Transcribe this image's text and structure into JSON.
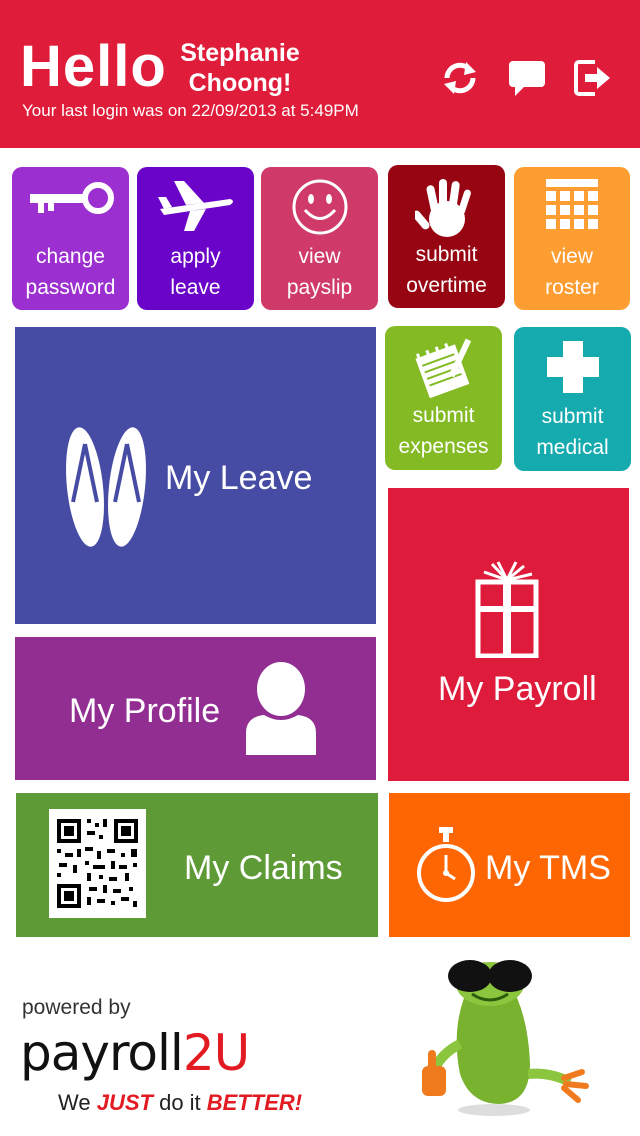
{
  "header": {
    "greeting": "Hello",
    "user_name_line1": "Stephanie",
    "user_name_line2": "Choong!",
    "last_login": "Your last login was on 22/09/2013 at 5:49PM",
    "icons": [
      "refresh-icon",
      "chat-icon",
      "logout-icon"
    ],
    "color": "#df1c39"
  },
  "small_tiles": [
    {
      "line1": "change",
      "line2": "password",
      "icon": "key-icon",
      "color": "#9c2fcf"
    },
    {
      "line1": "apply",
      "line2": "leave",
      "icon": "airplane-icon",
      "color": "#6a04c8"
    },
    {
      "line1": "view",
      "line2": "payslip",
      "icon": "smiley-icon",
      "color": "#cf3a69"
    },
    {
      "line1": "submit",
      "line2": "overtime",
      "icon": "hand-icon",
      "color": "#980512"
    },
    {
      "line1": "view",
      "line2": "roster",
      "icon": "calendar-icon",
      "color": "#fd9d32"
    },
    {
      "line1": "submit",
      "line2": "expenses",
      "icon": "notepad-icon",
      "color": "#84bb25"
    },
    {
      "line1": "submit",
      "line2": "medical",
      "icon": "medical-cross-icon",
      "color": "#14aaae"
    }
  ],
  "big_tiles": {
    "leave": {
      "label": "My Leave",
      "icon": "flip-flops-icon",
      "color": "#464ca4"
    },
    "profile": {
      "label": "My Profile",
      "icon": "person-icon",
      "color": "#922e91"
    },
    "payroll": {
      "label": "My Payroll",
      "icon": "gift-icon",
      "color": "#df1b3b"
    },
    "claims": {
      "label": "My Claims",
      "icon": "qr-code-icon",
      "color": "#5e9b36"
    },
    "tms": {
      "label": "My TMS",
      "icon": "stopwatch-icon",
      "color": "#fd6603"
    }
  },
  "footer": {
    "powered_by": "powered by",
    "logo_text": "payroll2U",
    "tagline_pre": "We ",
    "tagline_em1": "JUST",
    "tagline_mid": " do it ",
    "tagline_em2": "BETTER!"
  }
}
